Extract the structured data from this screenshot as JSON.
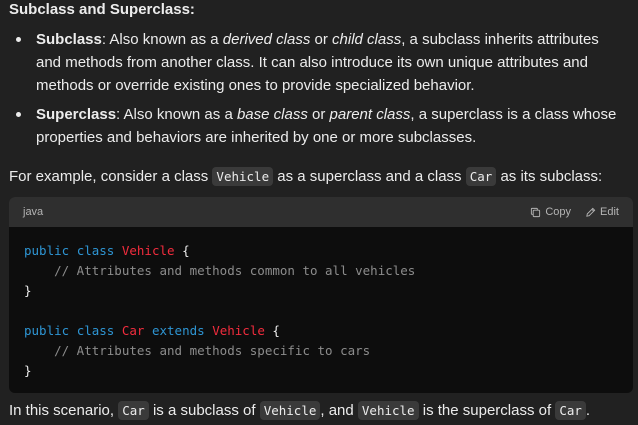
{
  "heading": "Subclass and Superclass:",
  "bullets": [
    {
      "term": "Subclass",
      "text_a": ": Also known as a ",
      "em1": "derived class",
      "text_b": " or ",
      "em2": "child class",
      "text_c": ", a subclass inherits attributes and methods from another class. It can also introduce its own unique attributes and methods or override existing ones to provide specialized behavior."
    },
    {
      "term": "Superclass",
      "text_a": ": Also known as a ",
      "em1": "base class",
      "text_b": " or ",
      "em2": "parent class",
      "text_c": ", a superclass is a class whose properties and behaviors are inherited by one or more subclasses."
    }
  ],
  "example": {
    "t1": "For example, consider a class ",
    "code1": "Vehicle",
    "t2": " as a superclass and a class ",
    "code2": "Car",
    "t3": " as its subclass:"
  },
  "codeblock": {
    "language": "java",
    "copy_label": "Copy",
    "edit_label": "Edit",
    "lines": [
      [
        {
          "t": "public",
          "c": "kw"
        },
        {
          "t": " ",
          "c": "plain"
        },
        {
          "t": "class",
          "c": "kw"
        },
        {
          "t": " ",
          "c": "plain"
        },
        {
          "t": "Vehicle",
          "c": "cls"
        },
        {
          "t": " {",
          "c": "plain"
        }
      ],
      [
        {
          "t": "    // Attributes and methods common to all vehicles",
          "c": "cm"
        }
      ],
      [
        {
          "t": "}",
          "c": "plain"
        }
      ],
      [],
      [
        {
          "t": "public",
          "c": "kw"
        },
        {
          "t": " ",
          "c": "plain"
        },
        {
          "t": "class",
          "c": "kw"
        },
        {
          "t": " ",
          "c": "plain"
        },
        {
          "t": "Car",
          "c": "cls"
        },
        {
          "t": " ",
          "c": "plain"
        },
        {
          "t": "extends",
          "c": "kw"
        },
        {
          "t": " ",
          "c": "plain"
        },
        {
          "t": "Vehicle",
          "c": "cls"
        },
        {
          "t": " {",
          "c": "plain"
        }
      ],
      [
        {
          "t": "    // Attributes and methods specific to cars",
          "c": "cm"
        }
      ],
      [
        {
          "t": "}",
          "c": "plain"
        }
      ]
    ]
  },
  "conclusion": {
    "t1": "In this scenario, ",
    "code1": "Car",
    "t2": " is a subclass of ",
    "code2": "Vehicle",
    "t3": ", and ",
    "code3": "Vehicle",
    "t4": " is the superclass of ",
    "code4": "Car",
    "t5": "."
  },
  "colors": {
    "background": "#212121",
    "keyword": "#2e95d3",
    "class_name": "#f22c3d",
    "comment": "#8c8c8c"
  }
}
